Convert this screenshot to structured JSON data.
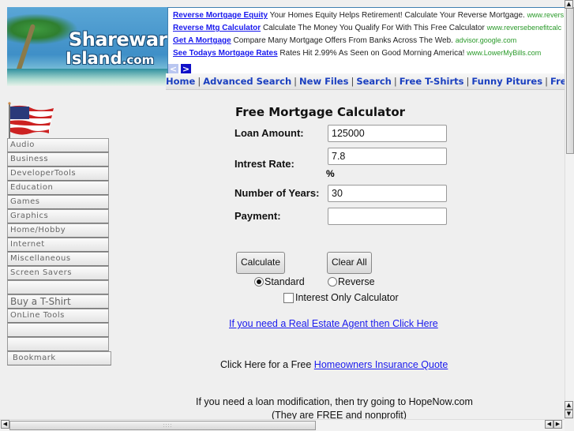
{
  "logo": {
    "line1": "Shareware",
    "line2": "Island",
    "line2_suffix": ".com"
  },
  "ads": [
    {
      "title": "Reverse Mortgage Equity",
      "text": "Your Homes Equity Helps Retirement! Calculate Your Reverse Mortgage.",
      "url": "www.revers"
    },
    {
      "title": "Reverse Mtg Calculator",
      "text": "Calculate The Money You Qualify For With This Free Calculator",
      "url": "www.reversebenefitcalc"
    },
    {
      "title": "Get A Mortgage",
      "text": "Compare Many Mortgage Offers From Banks Across The Web.",
      "url": "advisor.google.com"
    },
    {
      "title": "See Todays Mortgage Rates",
      "text": "Rates Hit 2.99% As Seen on Good Morning America!",
      "url": "www.LowerMyBills.com"
    }
  ],
  "ad_nav": {
    "prev": "<",
    "next": ">"
  },
  "topnav": [
    "Home",
    "Advanced Search",
    "New Files",
    "Search",
    "Free T-Shirts",
    "Funny Pitures",
    "Freebies"
  ],
  "topnav_sep": "|",
  "sidebar": [
    "Audio",
    "Business",
    "DeveloperTools",
    "Education",
    "Games",
    "Graphics",
    "Home/Hobby",
    "Internet",
    "Miscellaneous",
    "Screen Savers",
    "",
    "Buy a T-Shirt",
    "OnLine Tools",
    "",
    "",
    "Bookmark"
  ],
  "calculator": {
    "title": "Free Mortgage Calculator",
    "loan_amount_label": "Loan Amount:",
    "loan_amount_value": "125000",
    "rate_label": "Intrest Rate:",
    "rate_value": "7.8",
    "rate_suffix": "%",
    "years_label": "Number of Years:",
    "years_value": "30",
    "payment_label": "Payment:",
    "payment_value": "",
    "calculate_button": "Calculate",
    "clear_button": "Clear All",
    "radio_standard": "Standard",
    "radio_reverse": "Reverse",
    "selected_mode": "Standard",
    "interest_only_label": "Interest Only Calculator",
    "interest_only_checked": false
  },
  "links": {
    "real_estate": "If you need a Real Estate Agent then Click Here",
    "insurance_prefix": "Click Here for a Free",
    "insurance_link": "Homeowners Insurance Quote",
    "loan_mod_line1": "If you need a loan modification, then try going to HopeNow.com",
    "loan_mod_line2": "(They are FREE and nonprofit)"
  },
  "scrollbar_glyphs": {
    "up": "▲",
    "down": "▼",
    "left": "◀",
    "right": "▶"
  }
}
